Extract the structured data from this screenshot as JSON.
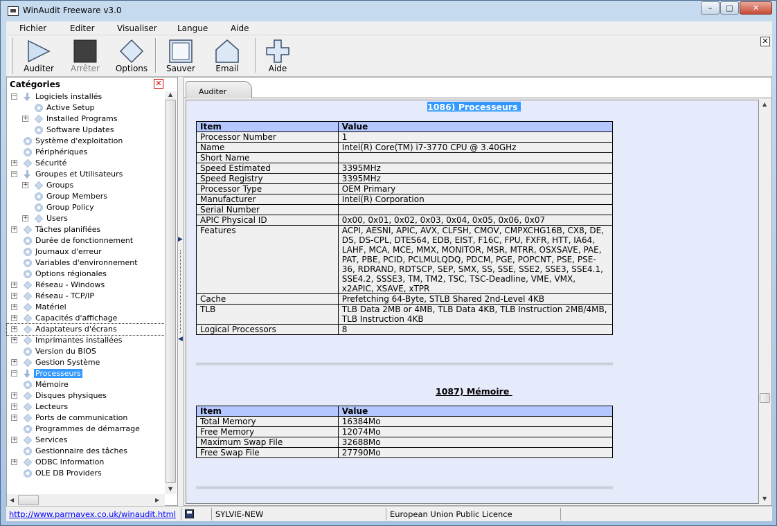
{
  "window": {
    "title": "WinAudit Freeware v3.0",
    "min": "–",
    "max": "□",
    "close": "✕"
  },
  "menu": [
    {
      "label": "Fichier"
    },
    {
      "label": "Editer"
    },
    {
      "label": "Visualiser"
    },
    {
      "label": "Langue"
    },
    {
      "label": "Aide"
    }
  ],
  "toolbar": {
    "auditer": "Auditer",
    "arreter": "Arrêter",
    "options": "Options",
    "sauver": "Sauver",
    "email": "Email",
    "aide": "Aide",
    "close": "✕"
  },
  "sidebar": {
    "header": "Catégories",
    "close": "✕",
    "items": [
      {
        "label": "Logiciels installés",
        "level": 0,
        "expander": "−",
        "icon": "arrow-down-icon"
      },
      {
        "label": "Active Setup",
        "level": 1,
        "expander": "",
        "icon": "gear-icon"
      },
      {
        "label": "Installed Programs",
        "level": 1,
        "expander": "+",
        "icon": "diamond-icon"
      },
      {
        "label": "Software Updates",
        "level": 1,
        "expander": "",
        "icon": "gear-icon"
      },
      {
        "label": "Système d'exploitation",
        "level": 0,
        "expander": "",
        "icon": "gear-icon"
      },
      {
        "label": "Périphériques",
        "level": 0,
        "expander": "",
        "icon": "gear-icon"
      },
      {
        "label": "Sécurité",
        "level": 0,
        "expander": "+",
        "icon": "diamond-icon"
      },
      {
        "label": "Groupes et Utilisateurs",
        "level": 0,
        "expander": "−",
        "icon": "arrow-down-icon"
      },
      {
        "label": "Groups",
        "level": 1,
        "expander": "+",
        "icon": "diamond-icon"
      },
      {
        "label": "Group Members",
        "level": 1,
        "expander": "",
        "icon": "gear-icon"
      },
      {
        "label": "Group Policy",
        "level": 1,
        "expander": "",
        "icon": "gear-icon"
      },
      {
        "label": "Users",
        "level": 1,
        "expander": "+",
        "icon": "diamond-icon"
      },
      {
        "label": "Tâches planifiées",
        "level": 0,
        "expander": "+",
        "icon": "diamond-icon"
      },
      {
        "label": "Durée de fonctionnement",
        "level": 0,
        "expander": "",
        "icon": "gear-icon"
      },
      {
        "label": "Journaux d'erreur",
        "level": 0,
        "expander": "",
        "icon": "gear-icon"
      },
      {
        "label": "Variables d'environnement",
        "level": 0,
        "expander": "",
        "icon": "gear-icon"
      },
      {
        "label": "Options régionales",
        "level": 0,
        "expander": "",
        "icon": "gear-icon"
      },
      {
        "label": "Réseau - Windows",
        "level": 0,
        "expander": "+",
        "icon": "diamond-icon"
      },
      {
        "label": "Réseau - TCP/IP",
        "level": 0,
        "expander": "+",
        "icon": "diamond-icon"
      },
      {
        "label": "Matériel",
        "level": 0,
        "expander": "+",
        "icon": "diamond-icon"
      },
      {
        "label": "Capacités d'affichage",
        "level": 0,
        "expander": "+",
        "icon": "diamond-icon"
      },
      {
        "label": "Adaptateurs d'écrans",
        "level": 0,
        "expander": "+",
        "icon": "diamond-icon",
        "focused": true
      },
      {
        "label": "Imprimantes installées",
        "level": 0,
        "expander": "+",
        "icon": "diamond-icon"
      },
      {
        "label": "Version du BIOS",
        "level": 0,
        "expander": "",
        "icon": "gear-icon"
      },
      {
        "label": "Gestion Système",
        "level": 0,
        "expander": "+",
        "icon": "diamond-icon"
      },
      {
        "label": "Processeurs",
        "level": 0,
        "expander": "−",
        "icon": "arrow-down-icon",
        "selected": true
      },
      {
        "label": "Mémoire",
        "level": 0,
        "expander": "",
        "icon": "gear-icon"
      },
      {
        "label": "Disques physiques",
        "level": 0,
        "expander": "+",
        "icon": "diamond-icon"
      },
      {
        "label": "Lecteurs",
        "level": 0,
        "expander": "+",
        "icon": "diamond-icon"
      },
      {
        "label": "Ports de communication",
        "level": 0,
        "expander": "+",
        "icon": "diamond-icon"
      },
      {
        "label": "Programmes de démarrage",
        "level": 0,
        "expander": "",
        "icon": "gear-icon"
      },
      {
        "label": "Services",
        "level": 0,
        "expander": "+",
        "icon": "diamond-icon"
      },
      {
        "label": "Gestionnaire des tâches",
        "level": 0,
        "expander": "",
        "icon": "gear-icon"
      },
      {
        "label": "ODBC Information",
        "level": 0,
        "expander": "+",
        "icon": "diamond-icon"
      },
      {
        "label": "OLE DB Providers",
        "level": 0,
        "expander": "",
        "icon": "gear-icon"
      }
    ]
  },
  "tab": {
    "label": "Auditer"
  },
  "processors": {
    "title": "1086) Processeurs ",
    "headers": [
      "Item",
      "Value"
    ],
    "rows": [
      [
        "Processor Number",
        "1"
      ],
      [
        "Name",
        "Intel(R) Core(TM) i7-3770 CPU @ 3.40GHz"
      ],
      [
        "Short Name",
        ""
      ],
      [
        "Speed Estimated",
        "3395MHz"
      ],
      [
        "Speed Registry",
        "3395MHz"
      ],
      [
        "Processor Type",
        "OEM Primary"
      ],
      [
        "Manufacturer",
        "Intel(R) Corporation"
      ],
      [
        "Serial Number",
        ""
      ],
      [
        "APIC Physical ID",
        "0x00, 0x01, 0x02, 0x03, 0x04, 0x05, 0x06, 0x07"
      ],
      [
        "Features",
        "ACPI, AESNI, APIC, AVX, CLFSH, CMOV, CMPXCHG16B, CX8, DE, DS, DS-CPL, DTES64, EDB, EIST, F16C, FPU, FXFR, HTT, IA64, LAHF, MCA, MCE, MMX, MONITOR, MSR, MTRR, OSXSAVE, PAE, PAT, PBE, PCID, PCLMULQDQ, PDCM, PGE, POPCNT, PSE, PSE-36, RDRAND, RDTSCP, SEP, SMX, SS, SSE, SSE2, SSE3, SSE4.1, SSE4.2, SSSE3, TM, TM2, TSC, TSC-Deadline, VME, VMX, x2APIC, XSAVE, xTPR"
      ],
      [
        "Cache",
        "Prefetching 64-Byte, STLB Shared 2nd-Level 4KB"
      ],
      [
        "TLB",
        "TLB Data 2MB or 4MB, TLB Data 4KB, TLB Instruction 2MB/4MB, TLB Instruction 4KB"
      ],
      [
        "Logical Processors",
        "8"
      ]
    ]
  },
  "memory": {
    "title": "1087) Mémoire ",
    "headers": [
      "Item",
      "Value"
    ],
    "rows": [
      [
        "Total Memory",
        "16384Mo"
      ],
      [
        "Free Memory",
        "12074Mo"
      ],
      [
        "Maximum Swap File",
        "32688Mo"
      ],
      [
        "Free Swap File",
        "27790Mo"
      ]
    ]
  },
  "status": {
    "link": "http://www.parmavex.co.uk/winaudit.html",
    "computer": "SYLVIE-NEW",
    "licence": "European Union Public Licence"
  }
}
